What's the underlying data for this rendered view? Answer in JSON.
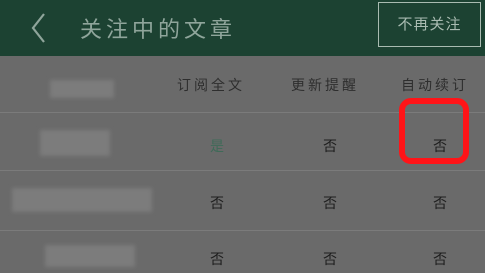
{
  "header": {
    "title": "关注中的文章",
    "unfollow_label": "不再关注",
    "back_icon": "chevron-left-icon",
    "bg_color": "#1c4232"
  },
  "columns": {
    "subscribe": "订阅全文",
    "update_remind": "更新提醒",
    "auto_subscribe": "自动续订"
  },
  "rows": [
    {
      "subscribe": "是",
      "update_remind": "否",
      "auto_subscribe": "否"
    },
    {
      "subscribe": "否",
      "update_remind": "否",
      "auto_subscribe": "否"
    },
    {
      "subscribe": "否",
      "update_remind": "否",
      "auto_subscribe": "否"
    }
  ],
  "annotation_color": "#ff1418"
}
